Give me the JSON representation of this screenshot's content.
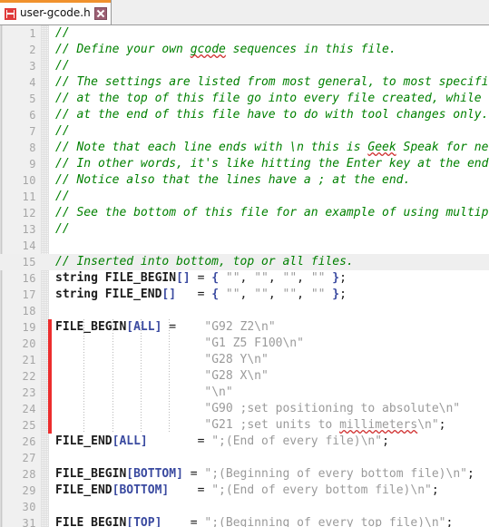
{
  "window": {
    "app": "code-editor",
    "accent_color": "#f0912d",
    "gutter_color": "#f0f0f0",
    "changebar_color": "#ec2d2d",
    "comment_color": "#008000",
    "string_color": "#9a9a9a",
    "bracket_color": "#3a4aa0",
    "highlight_color": "#efefef"
  },
  "tabbar": {
    "tabs": [
      {
        "title": "user-gcode.h",
        "active": true,
        "modified": true,
        "save_icon": "save-icon",
        "close_icon": "close-icon"
      }
    ]
  },
  "editor": {
    "current_line": 15,
    "changebar_lines": [
      19,
      25
    ],
    "first_line": 1,
    "last_line": 31,
    "lines": [
      {
        "n": 1,
        "tokens": [
          {
            "t": "comment",
            "v": "//"
          }
        ]
      },
      {
        "n": 2,
        "tokens": [
          {
            "t": "comment",
            "v": "// Define your own "
          },
          {
            "t": "comment-misspelled",
            "v": "gcode"
          },
          {
            "t": "comment",
            "v": " sequences in this file."
          }
        ]
      },
      {
        "n": 3,
        "tokens": [
          {
            "t": "comment",
            "v": "//"
          }
        ]
      },
      {
        "n": 4,
        "tokens": [
          {
            "t": "comment",
            "v": "// The settings are listed from most general, to most specific. The settings"
          }
        ]
      },
      {
        "n": 5,
        "tokens": [
          {
            "t": "comment",
            "v": "// at the top of this file go into every file created, while the settings"
          }
        ]
      },
      {
        "n": 6,
        "tokens": [
          {
            "t": "comment",
            "v": "// at the end of this file have to do with tool changes only."
          }
        ]
      },
      {
        "n": 7,
        "tokens": [
          {
            "t": "comment",
            "v": "//"
          }
        ]
      },
      {
        "n": 8,
        "tokens": [
          {
            "t": "comment",
            "v": "// Note that each line ends with \\n this is "
          },
          {
            "t": "comment-misspelled",
            "v": "Geek"
          },
          {
            "t": "comment",
            "v": " Speak for new line."
          }
        ]
      },
      {
        "n": 9,
        "tokens": [
          {
            "t": "comment",
            "v": "// In other words, it's like hitting the Enter key at the end of a line."
          }
        ]
      },
      {
        "n": 10,
        "tokens": [
          {
            "t": "comment",
            "v": "// Notice also that the lines have a ; at the end."
          }
        ]
      },
      {
        "n": 11,
        "tokens": [
          {
            "t": "comment",
            "v": "//"
          }
        ]
      },
      {
        "n": 12,
        "tokens": [
          {
            "t": "comment",
            "v": "// See the bottom of this file for an example of using multiple lines."
          }
        ]
      },
      {
        "n": 13,
        "tokens": [
          {
            "t": "comment",
            "v": "//"
          }
        ]
      },
      {
        "n": 14,
        "tokens": []
      },
      {
        "n": 15,
        "tokens": [
          {
            "t": "comment",
            "v": "// Inserted into bottom, top or all files."
          }
        ]
      },
      {
        "n": 16,
        "tokens": [
          {
            "t": "keyword",
            "v": "string"
          },
          {
            "t": "plain",
            "v": " "
          },
          {
            "t": "ident",
            "v": "FILE_BEGIN"
          },
          {
            "t": "bracket",
            "v": "[]"
          },
          {
            "t": "plain",
            "v": " "
          },
          {
            "t": "op",
            "v": "="
          },
          {
            "t": "plain",
            "v": " "
          },
          {
            "t": "bracket",
            "v": "{"
          },
          {
            "t": "plain",
            "v": " "
          },
          {
            "t": "string",
            "v": "\"\""
          },
          {
            "t": "punc",
            "v": ","
          },
          {
            "t": "plain",
            "v": " "
          },
          {
            "t": "string",
            "v": "\"\""
          },
          {
            "t": "punc",
            "v": ","
          },
          {
            "t": "plain",
            "v": " "
          },
          {
            "t": "string",
            "v": "\"\""
          },
          {
            "t": "punc",
            "v": ","
          },
          {
            "t": "plain",
            "v": " "
          },
          {
            "t": "string",
            "v": "\"\""
          },
          {
            "t": "plain",
            "v": " "
          },
          {
            "t": "bracket",
            "v": "}"
          },
          {
            "t": "punc",
            "v": ";"
          }
        ]
      },
      {
        "n": 17,
        "tokens": [
          {
            "t": "keyword",
            "v": "string"
          },
          {
            "t": "plain",
            "v": " "
          },
          {
            "t": "ident",
            "v": "FILE_END"
          },
          {
            "t": "bracket",
            "v": "[]"
          },
          {
            "t": "plain",
            "v": "   "
          },
          {
            "t": "op",
            "v": "="
          },
          {
            "t": "plain",
            "v": " "
          },
          {
            "t": "bracket",
            "v": "{"
          },
          {
            "t": "plain",
            "v": " "
          },
          {
            "t": "string",
            "v": "\"\""
          },
          {
            "t": "punc",
            "v": ","
          },
          {
            "t": "plain",
            "v": " "
          },
          {
            "t": "string",
            "v": "\"\""
          },
          {
            "t": "punc",
            "v": ","
          },
          {
            "t": "plain",
            "v": " "
          },
          {
            "t": "string",
            "v": "\"\""
          },
          {
            "t": "punc",
            "v": ","
          },
          {
            "t": "plain",
            "v": " "
          },
          {
            "t": "string",
            "v": "\"\""
          },
          {
            "t": "plain",
            "v": " "
          },
          {
            "t": "bracket",
            "v": "}"
          },
          {
            "t": "punc",
            "v": ";"
          }
        ]
      },
      {
        "n": 18,
        "tokens": []
      },
      {
        "n": 19,
        "tokens": [
          {
            "t": "ident",
            "v": "FILE_BEGIN"
          },
          {
            "t": "bracket",
            "v": "[ALL]"
          },
          {
            "t": "plain",
            "v": " "
          },
          {
            "t": "op",
            "v": "="
          },
          {
            "t": "plain",
            "v": "    "
          },
          {
            "t": "string",
            "v": "\"G92 Z2\\n\""
          }
        ]
      },
      {
        "n": 20,
        "tokens": [
          {
            "t": "plain",
            "v": "                     "
          },
          {
            "t": "string",
            "v": "\"G1 Z5 F100\\n\""
          }
        ]
      },
      {
        "n": 21,
        "tokens": [
          {
            "t": "plain",
            "v": "                     "
          },
          {
            "t": "string",
            "v": "\"G28 Y\\n\""
          }
        ]
      },
      {
        "n": 22,
        "tokens": [
          {
            "t": "plain",
            "v": "                     "
          },
          {
            "t": "string",
            "v": "\"G28 X\\n\""
          }
        ]
      },
      {
        "n": 23,
        "tokens": [
          {
            "t": "plain",
            "v": "                     "
          },
          {
            "t": "string",
            "v": "\"\\n\""
          }
        ]
      },
      {
        "n": 24,
        "tokens": [
          {
            "t": "plain",
            "v": "                     "
          },
          {
            "t": "string",
            "v": "\"G90 ;set positioning to absolute\\n\""
          }
        ]
      },
      {
        "n": 25,
        "tokens": [
          {
            "t": "plain",
            "v": "                     "
          },
          {
            "t": "string",
            "v": "\"G21 ;set units to "
          },
          {
            "t": "string-misspelled",
            "v": "millimeters"
          },
          {
            "t": "string",
            "v": "\\n\""
          },
          {
            "t": "punc",
            "v": ";"
          }
        ]
      },
      {
        "n": 26,
        "tokens": [
          {
            "t": "ident",
            "v": "FILE_END"
          },
          {
            "t": "bracket",
            "v": "[ALL]"
          },
          {
            "t": "plain",
            "v": "       "
          },
          {
            "t": "op",
            "v": "="
          },
          {
            "t": "plain",
            "v": " "
          },
          {
            "t": "string",
            "v": "\";(End of every file)\\n\""
          },
          {
            "t": "punc",
            "v": ";"
          }
        ]
      },
      {
        "n": 27,
        "tokens": []
      },
      {
        "n": 28,
        "tokens": [
          {
            "t": "ident",
            "v": "FILE_BEGIN"
          },
          {
            "t": "bracket",
            "v": "[BOTTOM]"
          },
          {
            "t": "plain",
            "v": " "
          },
          {
            "t": "op",
            "v": "="
          },
          {
            "t": "plain",
            "v": " "
          },
          {
            "t": "string",
            "v": "\";(Beginning of every bottom file)\\n\""
          },
          {
            "t": "punc",
            "v": ";"
          }
        ]
      },
      {
        "n": 29,
        "tokens": [
          {
            "t": "ident",
            "v": "FILE_END"
          },
          {
            "t": "bracket",
            "v": "[BOTTOM]"
          },
          {
            "t": "plain",
            "v": "    "
          },
          {
            "t": "op",
            "v": "="
          },
          {
            "t": "plain",
            "v": " "
          },
          {
            "t": "string",
            "v": "\";(End of every bottom file)\\n\""
          },
          {
            "t": "punc",
            "v": ";"
          }
        ]
      },
      {
        "n": 30,
        "tokens": []
      },
      {
        "n": 31,
        "tokens": [
          {
            "t": "ident",
            "v": "FILE_BEGIN"
          },
          {
            "t": "bracket",
            "v": "[TOP]"
          },
          {
            "t": "plain",
            "v": "    "
          },
          {
            "t": "op",
            "v": "="
          },
          {
            "t": "plain",
            "v": " "
          },
          {
            "t": "string",
            "v": "\";(Beginning of every top file)\\n\""
          },
          {
            "t": "punc",
            "v": ";"
          }
        ]
      }
    ]
  }
}
